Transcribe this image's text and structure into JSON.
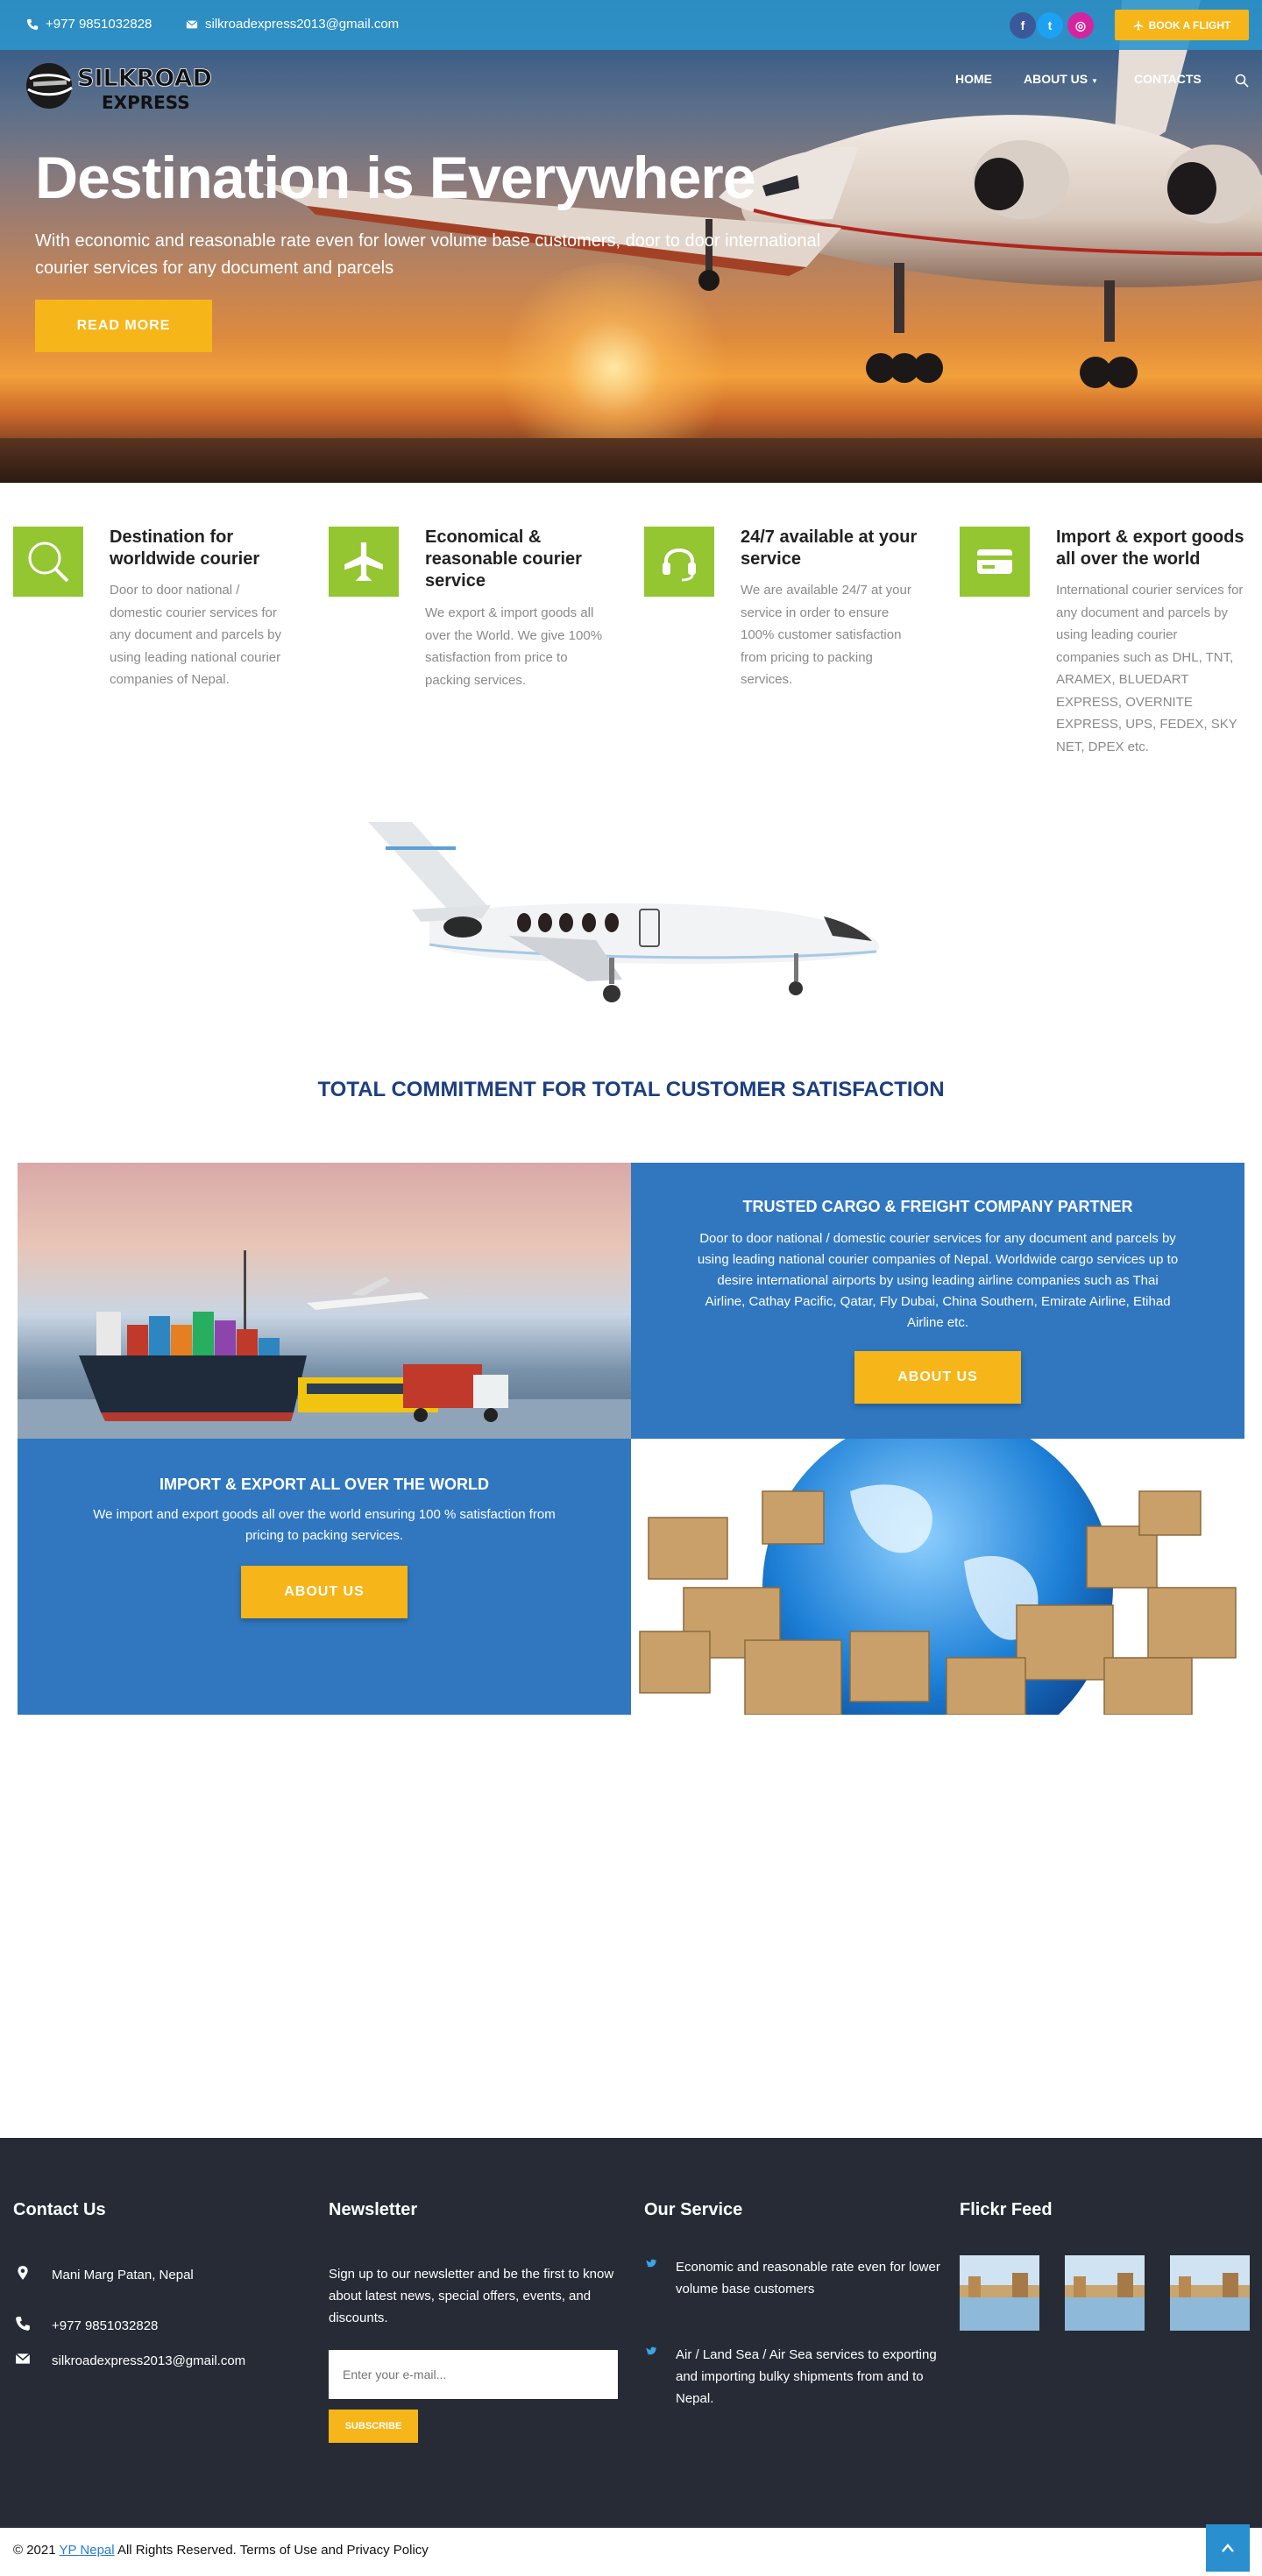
{
  "topbar": {
    "phone": "+977 9851032828",
    "email": "silkroadexpress2013@gmail.com",
    "social": [
      {
        "name": "facebook-icon",
        "glyph": "f",
        "color": "#3b5998"
      },
      {
        "name": "twitter-icon",
        "glyph": "t",
        "color": "#1da1f2"
      },
      {
        "name": "instagram-icon",
        "glyph": "◎",
        "color": "#d6249f"
      }
    ],
    "book_label": "BOOK A FLIGHT"
  },
  "logo": {
    "line1": "SILKROAD",
    "line2": "EXPRESS"
  },
  "nav": {
    "home": "HOME",
    "about": "ABOUT US",
    "contacts": "CONTACTS"
  },
  "hero": {
    "title": "Destination is Everywhere",
    "subtitle": "With economic and reasonable rate even for lower volume base customers, door to door international courier services for any document and parcels",
    "button": "READ MORE"
  },
  "features": [
    {
      "icon": "search-icon",
      "title": "Destination for worldwide courier",
      "text": "Door to door national / domestic courier services for any document and parcels by using leading national courier companies of Nepal."
    },
    {
      "icon": "airplane-icon",
      "title": "Economical & reasonable courier service",
      "text": "We export & import goods all over the World. We give 100% satisfaction from price to packing services."
    },
    {
      "icon": "headset-icon",
      "title": "24/7 available at your service",
      "text": "We are available 24/7 at your service in order to ensure 100% customer satisfaction from pricing to packing services."
    },
    {
      "icon": "credit-card-icon",
      "title": "Import & export goods all over the world",
      "text": "International courier services for any document and parcels by using leading courier companies such as DHL, TNT, ARAMEX, BLUEDART EXPRESS, OVERNITE EXPRESS, UPS, FEDEX, SKY NET, DPEX etc."
    }
  ],
  "commitment": "TOTAL COMMITMENT FOR TOTAL CUSTOMER SATISFACTION",
  "cargo": {
    "title": "TRUSTED CARGO & FREIGHT COMPANY PARTNER",
    "text": "Door to door national / domestic courier services for any document and parcels by using leading national courier companies of Nepal. Worldwide cargo services up to desire international airports by using leading airline companies such as Thai Airline, Cathay Pacific, Qatar, Fly Dubai, China Southern, Emirate Airline, Etihad Airline etc.",
    "button": "ABOUT US"
  },
  "import_export": {
    "title": "IMPORT & EXPORT ALL OVER THE WORLD",
    "text": "We import and export goods all over the world ensuring 100 % satisfaction from pricing to packing services.",
    "button": "ABOUT US"
  },
  "footer": {
    "contact": {
      "title": "Contact Us",
      "address": "Mani Marg Patan, Nepal",
      "phone": "+977 9851032828",
      "email": "silkroadexpress2013@gmail.com"
    },
    "newsletter": {
      "title": "Newsletter",
      "text": "Sign up to our newsletter and be the first to know about latest news, special offers, events, and discounts.",
      "placeholder": "Enter your e-mail...",
      "button": "SUBSCRIBE"
    },
    "service": {
      "title": "Our Service",
      "items": [
        "Economic and reasonable rate even for lower volume base customers",
        "Air / Land Sea / Air Sea services to exporting and importing bulky shipments from and to Nepal."
      ]
    },
    "flickr": {
      "title": "Flickr Feed"
    }
  },
  "copyright": {
    "prefix": "© 2021",
    "link": "YP Nepal",
    "suffix": "All Rights Reserved. Terms of Use and Privacy Policy"
  },
  "colors": {
    "accent": "#f6b519",
    "green": "#93c631",
    "blue": "#3077c0",
    "topbar": "#2c96cd",
    "footer": "#272b36",
    "heading": "#1c3f80"
  }
}
